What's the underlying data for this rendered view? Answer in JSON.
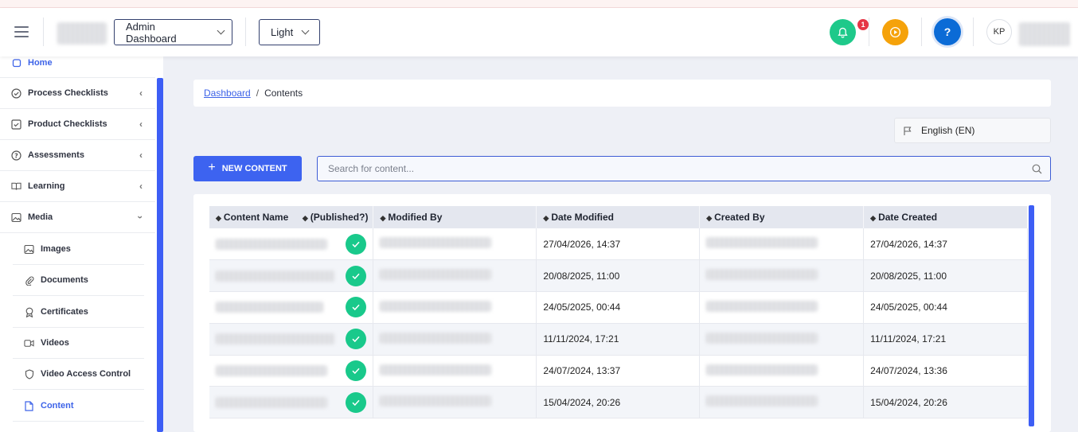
{
  "topbar": {
    "dashboard_select": "Admin Dashboard",
    "theme_select": "Light",
    "notification_count": "1",
    "avatar_initials": "KP",
    "help_label": "?"
  },
  "sidebar": {
    "items": [
      {
        "label": "Home",
        "icon": "home-icon",
        "active": true
      },
      {
        "label": "Process Checklists",
        "icon": "check-circle-icon"
      },
      {
        "label": "Product Checklists",
        "icon": "check-square-icon"
      },
      {
        "label": "Assessments",
        "icon": "question-circle-icon"
      },
      {
        "label": "Learning",
        "icon": "book-icon"
      },
      {
        "label": "Media",
        "icon": "image-icon"
      }
    ],
    "media_children": [
      {
        "label": "Images",
        "icon": "image-icon"
      },
      {
        "label": "Documents",
        "icon": "paperclip-icon"
      },
      {
        "label": "Certificates",
        "icon": "award-icon"
      },
      {
        "label": "Videos",
        "icon": "video-icon"
      },
      {
        "label": "Video Access Control",
        "icon": "shield-icon"
      },
      {
        "label": "Content",
        "icon": "file-icon",
        "active": true
      }
    ]
  },
  "breadcrumb": {
    "link": "Dashboard",
    "separator": "/",
    "current": "Contents"
  },
  "language": "English (EN)",
  "toolbar": {
    "new_button": "NEW CONTENT",
    "search_placeholder": "Search for content..."
  },
  "table": {
    "headers": [
      "Content Name",
      "(Published?)",
      "Modified By",
      "Date Modified",
      "Created By",
      "Date Created"
    ],
    "rows": [
      {
        "modified": "27/04/2026, 14:37",
        "created": "27/04/2026, 14:37",
        "published": true
      },
      {
        "modified": "20/08/2025, 11:00",
        "created": "20/08/2025, 11:00",
        "published": true
      },
      {
        "modified": "24/05/2025, 00:44",
        "created": "24/05/2025, 00:44",
        "published": true
      },
      {
        "modified": "11/11/2024, 17:21",
        "created": "11/11/2024, 17:21",
        "published": true
      },
      {
        "modified": "24/07/2024, 13:37",
        "created": "24/07/2024, 13:36",
        "published": true
      },
      {
        "modified": "15/04/2024, 20:26",
        "created": "15/04/2024, 20:26",
        "published": true
      }
    ]
  },
  "colors": {
    "accent": "#3d63f0",
    "success": "#19c98b",
    "notify": "#1ec98a",
    "play": "#f5a20a",
    "help": "#0b6bd6",
    "badge": "#e53545"
  }
}
